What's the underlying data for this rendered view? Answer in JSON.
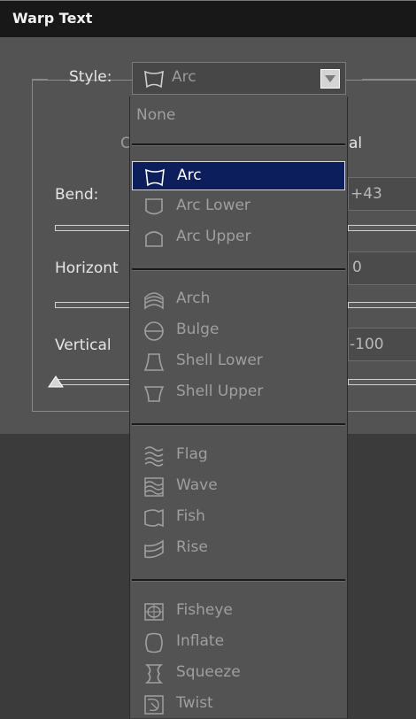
{
  "window": {
    "title": "Warp Text"
  },
  "style": {
    "label": "Style:",
    "current": "Arc",
    "current_icon": "arc-warp-icon"
  },
  "orientation": {
    "horizontal_partial": "C",
    "vertical_partial": "al"
  },
  "bend": {
    "label": "Bend:",
    "value": "+43"
  },
  "horizontal": {
    "label": "Horizont",
    "value": "0"
  },
  "vertical": {
    "label": "Vertical",
    "value": "-100"
  },
  "menu": {
    "none_label": "None",
    "items": [
      {
        "label": "Arc",
        "icon": "arc-warp-icon",
        "selected": true
      },
      {
        "label": "Arc Lower",
        "icon": "arc-lower-warp-icon"
      },
      {
        "label": "Arc Upper",
        "icon": "arc-upper-warp-icon"
      },
      {
        "label": "Arch",
        "icon": "arch-warp-icon"
      },
      {
        "label": "Bulge",
        "icon": "bulge-warp-icon"
      },
      {
        "label": "Shell Lower",
        "icon": "shell-lower-warp-icon"
      },
      {
        "label": "Shell Upper",
        "icon": "shell-upper-warp-icon"
      },
      {
        "label": "Flag",
        "icon": "flag-warp-icon"
      },
      {
        "label": "Wave",
        "icon": "wave-warp-icon"
      },
      {
        "label": "Fish",
        "icon": "fish-warp-icon"
      },
      {
        "label": "Rise",
        "icon": "rise-warp-icon"
      },
      {
        "label": "Fisheye",
        "icon": "fisheye-warp-icon"
      },
      {
        "label": "Inflate",
        "icon": "inflate-warp-icon"
      },
      {
        "label": "Squeeze",
        "icon": "squeeze-warp-icon"
      },
      {
        "label": "Twist",
        "icon": "twist-warp-icon"
      }
    ]
  },
  "colors": {
    "selection": "#0d1e5c",
    "dialog_bg": "#535353",
    "titlebar_bg": "#181818"
  }
}
